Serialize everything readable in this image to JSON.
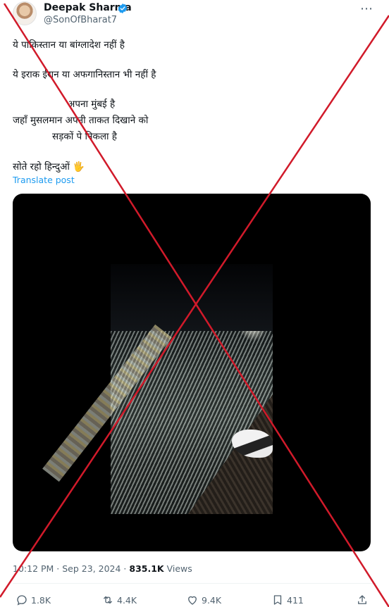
{
  "author": {
    "name": "Deepak Sharma",
    "handle": "@SonOfBharat7",
    "verified": true
  },
  "more_icon": "⋯",
  "post": {
    "lines": [
      "ये पाकिस्तान या बांग्लादेश नहीं है",
      "ये इराक ईरान या अफगानिस्तान भी नहीं है",
      "अपना मुंबई है",
      "जहाँ मुसलमान अपनी ताकत दिखाने को",
      "सड़कों पे निकला है",
      "सोते रहो हिन्दुओं 🖐"
    ],
    "translate_label": "Translate post"
  },
  "media": {
    "type": "video",
    "icon": "video-thumbnail"
  },
  "meta": {
    "time": "10:12 PM",
    "separator": " · ",
    "date": "Sep 23, 2024",
    "views_count": "835.1K",
    "views_label": "Views"
  },
  "actions": {
    "replies": "1.8K",
    "reposts": "4.4K",
    "likes": "9.4K",
    "bookmarks": "411"
  },
  "colors": {
    "link": "#1d9bf0",
    "muted": "#536471",
    "text": "#0f1419",
    "overlay_cross": "#d11a2a"
  }
}
